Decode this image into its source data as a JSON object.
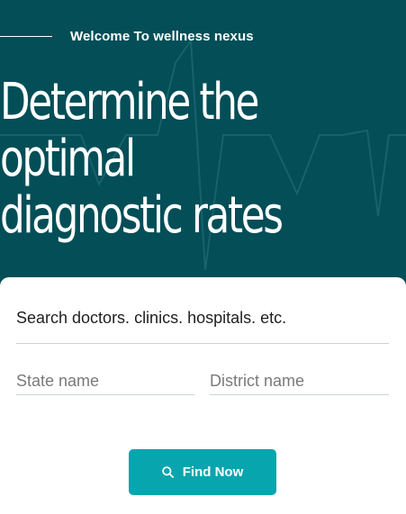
{
  "hero": {
    "tagline": "Welcome To wellness nexus",
    "headline_lines": [
      "Determine the",
      "optimal",
      "diagnostic rates"
    ]
  },
  "search": {
    "placeholder": "Search doctors. clinics. hospitals. etc."
  },
  "location": {
    "state_placeholder": "State name",
    "district_placeholder": "District name",
    "icon": "map-pin-icon"
  },
  "find": {
    "label": "Find Now",
    "icon": "search-icon"
  },
  "colors": {
    "hero_background": "#034e57",
    "accent": "#07a5ae",
    "card_background": "#ffffff"
  }
}
